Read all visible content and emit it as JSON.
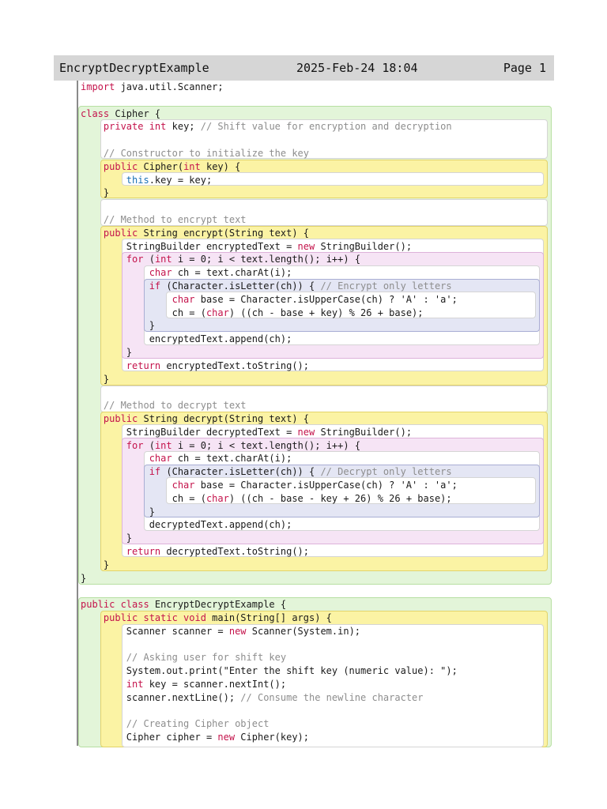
{
  "header": {
    "filename": "EncryptDecryptExample",
    "date": "2025-Feb-24 18:04",
    "page_label": "Page 1"
  },
  "code_lines": [
    [
      {
        "t": "import",
        "k": "kw"
      },
      {
        "t": " java.util.Scanner;"
      }
    ],
    [],
    [
      {
        "t": "class",
        "k": "kw"
      },
      {
        "t": " Cipher {"
      }
    ],
    [
      {
        "t": "    "
      },
      {
        "t": "private int",
        "k": "kw"
      },
      {
        "t": " key; "
      },
      {
        "t": "// Shift value for encryption and decryption",
        "k": "cm"
      }
    ],
    [],
    [
      {
        "t": "    "
      },
      {
        "t": "// Constructor to initialize the key",
        "k": "cm"
      }
    ],
    [
      {
        "t": "    "
      },
      {
        "t": "public",
        "k": "kw"
      },
      {
        "t": " Cipher("
      },
      {
        "t": "int",
        "k": "kw"
      },
      {
        "t": " key) {"
      }
    ],
    [
      {
        "t": "        "
      },
      {
        "t": "this",
        "k": "this"
      },
      {
        "t": ".key = key;"
      }
    ],
    [
      {
        "t": "    }"
      }
    ],
    [],
    [
      {
        "t": "    "
      },
      {
        "t": "// Method to encrypt text",
        "k": "cm"
      }
    ],
    [
      {
        "t": "    "
      },
      {
        "t": "public",
        "k": "kw"
      },
      {
        "t": " String encrypt(String text) {"
      }
    ],
    [
      {
        "t": "        StringBuilder encryptedText = "
      },
      {
        "t": "new",
        "k": "kw"
      },
      {
        "t": " StringBuilder();"
      }
    ],
    [
      {
        "t": "        "
      },
      {
        "t": "for",
        "k": "kw"
      },
      {
        "t": " ("
      },
      {
        "t": "int",
        "k": "kw"
      },
      {
        "t": " i = 0; i < text.length(); i++) {"
      }
    ],
    [
      {
        "t": "            "
      },
      {
        "t": "char",
        "k": "kw"
      },
      {
        "t": " ch = text.charAt(i);"
      }
    ],
    [
      {
        "t": "            "
      },
      {
        "t": "if",
        "k": "kw"
      },
      {
        "t": " (Character.isLetter(ch)) { "
      },
      {
        "t": "// Encrypt only letters",
        "k": "cm"
      }
    ],
    [
      {
        "t": "                "
      },
      {
        "t": "char",
        "k": "kw"
      },
      {
        "t": " base = Character.isUpperCase(ch) ? 'A' : 'a';"
      }
    ],
    [
      {
        "t": "                ch = ("
      },
      {
        "t": "char",
        "k": "kw"
      },
      {
        "t": ") ((ch - base + key) % 26 + base);"
      }
    ],
    [
      {
        "t": "            }"
      }
    ],
    [
      {
        "t": "            encryptedText.append(ch);"
      }
    ],
    [
      {
        "t": "        }"
      }
    ],
    [
      {
        "t": "        "
      },
      {
        "t": "return",
        "k": "kw"
      },
      {
        "t": " encryptedText.toString();"
      }
    ],
    [
      {
        "t": "    }"
      }
    ],
    [],
    [
      {
        "t": "    "
      },
      {
        "t": "// Method to decrypt text",
        "k": "cm"
      }
    ],
    [
      {
        "t": "    "
      },
      {
        "t": "public",
        "k": "kw"
      },
      {
        "t": " String decrypt(String text) {"
      }
    ],
    [
      {
        "t": "        StringBuilder decryptedText = "
      },
      {
        "t": "new",
        "k": "kw"
      },
      {
        "t": " StringBuilder();"
      }
    ],
    [
      {
        "t": "        "
      },
      {
        "t": "for",
        "k": "kw"
      },
      {
        "t": " ("
      },
      {
        "t": "int",
        "k": "kw"
      },
      {
        "t": " i = 0; i < text.length(); i++) {"
      }
    ],
    [
      {
        "t": "            "
      },
      {
        "t": "char",
        "k": "kw"
      },
      {
        "t": " ch = text.charAt(i);"
      }
    ],
    [
      {
        "t": "            "
      },
      {
        "t": "if",
        "k": "kw"
      },
      {
        "t": " (Character.isLetter(ch)) { "
      },
      {
        "t": "// Decrypt only letters",
        "k": "cm"
      }
    ],
    [
      {
        "t": "                "
      },
      {
        "t": "char",
        "k": "kw"
      },
      {
        "t": " base = Character.isUpperCase(ch) ? 'A' : 'a';"
      }
    ],
    [
      {
        "t": "                ch = ("
      },
      {
        "t": "char",
        "k": "kw"
      },
      {
        "t": ") ((ch - base - key + 26) % 26 + base);"
      }
    ],
    [
      {
        "t": "            }"
      }
    ],
    [
      {
        "t": "            decryptedText.append(ch);"
      }
    ],
    [
      {
        "t": "        }"
      }
    ],
    [
      {
        "t": "        "
      },
      {
        "t": "return",
        "k": "kw"
      },
      {
        "t": " decryptedText.toString();"
      }
    ],
    [
      {
        "t": "    }"
      }
    ],
    [
      {
        "t": "}"
      }
    ],
    [],
    [
      {
        "t": "public class",
        "k": "kw"
      },
      {
        "t": " EncryptDecryptExample {"
      }
    ],
    [
      {
        "t": "    "
      },
      {
        "t": "public static void",
        "k": "kw"
      },
      {
        "t": " main(String[] args) {"
      }
    ],
    [
      {
        "t": "        Scanner scanner = "
      },
      {
        "t": "new",
        "k": "kw"
      },
      {
        "t": " Scanner(System.in);"
      }
    ],
    [],
    [
      {
        "t": "        "
      },
      {
        "t": "// Asking user for shift key",
        "k": "cm"
      }
    ],
    [
      {
        "t": "        System.out.print(\"Enter the shift key (numeric value): \");"
      }
    ],
    [
      {
        "t": "        "
      },
      {
        "t": "int",
        "k": "kw"
      },
      {
        "t": " key = scanner.nextInt();"
      }
    ],
    [
      {
        "t": "        scanner.nextLine(); "
      },
      {
        "t": "// Consume the newline character",
        "k": "cm"
      }
    ],
    [],
    [
      {
        "t": "        "
      },
      {
        "t": "// Creating Cipher object",
        "k": "cm"
      }
    ],
    [
      {
        "t": "        Cipher cipher = "
      },
      {
        "t": "new",
        "k": "kw"
      },
      {
        "t": " Cipher(key);"
      }
    ]
  ]
}
